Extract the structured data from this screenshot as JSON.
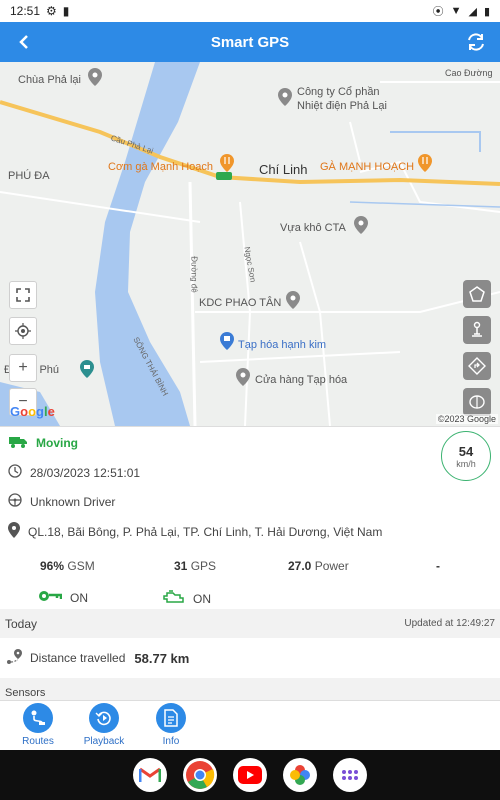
{
  "status_bar": {
    "time": "12:51",
    "gear_icon": "gear-icon",
    "sd_icon": "sd-card-icon"
  },
  "app_bar": {
    "title": "Smart GPS",
    "back_icon": "arrow-left-icon",
    "refresh_icon": "refresh-icon"
  },
  "map": {
    "labels": {
      "chua_pha_lai": "Chùa Phả lại",
      "cong_ty": "Công ty Cổ phần",
      "nhiet_dien": "Nhiệt điện Phả Lại",
      "cao_duong": "Cao Đường",
      "cau_pha_lai": "Cầu Phả Lại",
      "phu_da": "PHÚ ĐA",
      "com_ga_left": "Cơm gà Mạnh Hoạch",
      "chi_linh": "Chí Linh",
      "ga_manh_hoach": "GÀ MẠNH HOẠCH",
      "vua_kho": "Vựa khô CTA",
      "duong_de": "Đường đê",
      "ngoc_son": "Ngọc Sơn",
      "kdc": "KDC PHAO TÂN",
      "tap_hoa_hanh_kim": "Tạp hóa hạnh kim",
      "cua_hang": "Cửa hàng Tạp hóa",
      "dam_phu": "Đ...am Phú",
      "song": "SÔNG THÁI BÌNH"
    },
    "google_logo": "Google",
    "copyright": "©2023 Google",
    "controls_left": [
      "fullscreen-icon",
      "locate-icon",
      "zoom-in-icon",
      "zoom-out-icon"
    ],
    "controls_right": [
      "polygon-icon",
      "landmark-icon",
      "directions-icon",
      "geofence-icon"
    ]
  },
  "vehicle": {
    "status": "Moving",
    "datetime": "28/03/2023 12:51:01",
    "driver": "Unknown Driver",
    "address": "QL.18, Bãi Bông, P. Phả Lại, TP. Chí Linh, T. Hải Dương, Việt Nam",
    "speed_value": "54",
    "speed_unit": "km/h",
    "gsm_value": "96%",
    "gsm_label": "GSM",
    "gps_value": "31",
    "gps_label": "GPS",
    "power_value": "27.0",
    "power_label": "Power",
    "extra_value": "-",
    "key_state": "ON",
    "engine_state": "ON"
  },
  "today": {
    "label": "Today",
    "updated": "Updated at 12:49:27",
    "distance_label": "Distance travelled",
    "distance_value": "58.77 km"
  },
  "sensors_label": "Sensors",
  "bottom_nav": {
    "items": [
      {
        "label": "Routes",
        "icon": "routes-icon"
      },
      {
        "label": "Playback",
        "icon": "playback-icon"
      },
      {
        "label": "Info",
        "icon": "info-document-icon"
      }
    ]
  },
  "dock": {
    "apps": [
      "gmail-icon",
      "chrome-icon",
      "youtube-icon",
      "photos-icon",
      "app-drawer-icon"
    ]
  },
  "colors": {
    "primary": "#2d8ae6",
    "moving": "#28a745",
    "water": "#a8c8f0",
    "highway": "#f6c45a"
  }
}
